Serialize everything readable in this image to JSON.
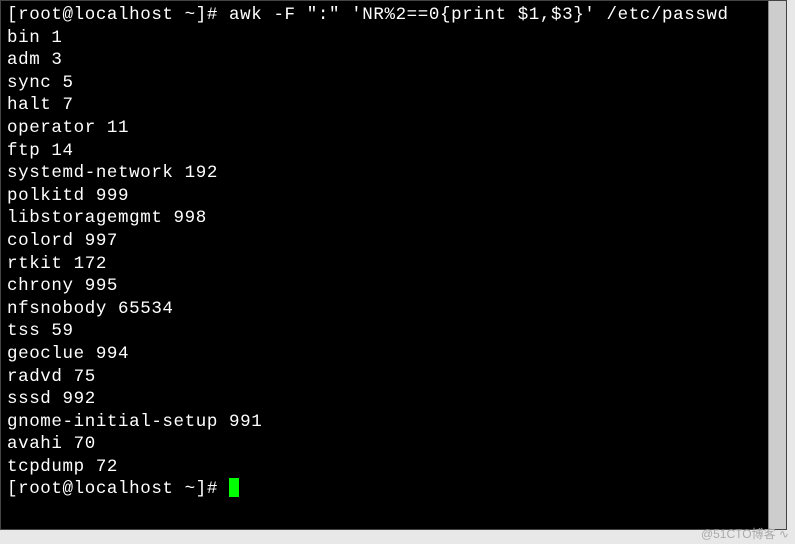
{
  "terminal": {
    "prompt1_user_host": "[root@localhost ~]# ",
    "command": "awk -F \":\" 'NR%2==0{print $1,$3}' /etc/passwd",
    "output": [
      "bin 1",
      "adm 3",
      "sync 5",
      "halt 7",
      "operator 11",
      "ftp 14",
      "systemd-network 192",
      "polkitd 999",
      "libstoragemgmt 998",
      "colord 997",
      "rtkit 172",
      "chrony 995",
      "nfsnobody 65534",
      "tss 59",
      "geoclue 994",
      "radvd 75",
      "sssd 992",
      "gnome-initial-setup 991",
      "avahi 70",
      "tcpdump 72"
    ],
    "prompt2_user_host": "[root@localhost ~]# "
  },
  "watermark": "@51CTO博客 ∿"
}
